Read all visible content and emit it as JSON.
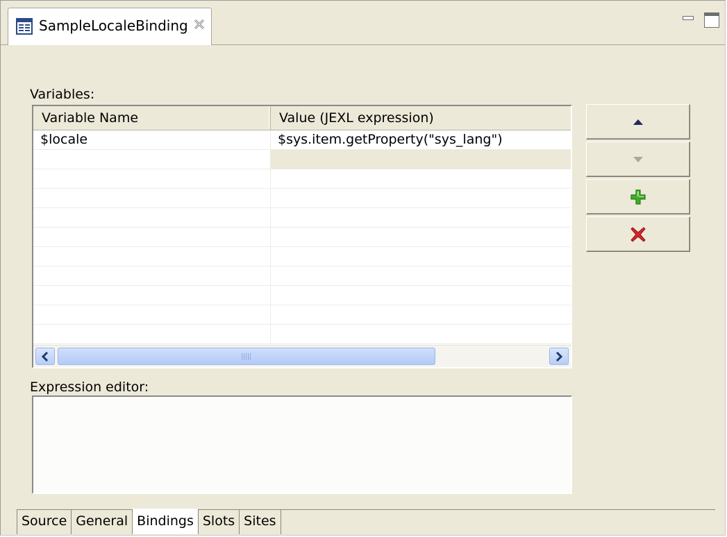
{
  "editor_tab": {
    "title": "SampleLocaleBinding",
    "icon": "form-editor-icon",
    "close_icon": "close-icon"
  },
  "window_controls": {
    "minimize_icon": "minimize-icon",
    "maximize_icon": "maximize-icon"
  },
  "variables": {
    "label": "Variables:",
    "columns": [
      "Variable Name",
      "Value (JEXL expression)"
    ],
    "rows": [
      {
        "name": "$locale",
        "value": "$sys.item.getProperty(\"sys_lang\")"
      },
      {
        "name": "",
        "value": ""
      },
      {
        "name": "",
        "value": ""
      },
      {
        "name": "",
        "value": ""
      },
      {
        "name": "",
        "value": ""
      },
      {
        "name": "",
        "value": ""
      },
      {
        "name": "",
        "value": ""
      },
      {
        "name": "",
        "value": ""
      },
      {
        "name": "",
        "value": ""
      },
      {
        "name": "",
        "value": ""
      },
      {
        "name": "",
        "value": ""
      }
    ],
    "scrollbar": {
      "left_icon": "chevron-left-icon",
      "right_icon": "chevron-right-icon"
    }
  },
  "expression_editor": {
    "label": "Expression editor:",
    "value": ""
  },
  "side_buttons": {
    "move_up_icon": "arrow-up-icon",
    "move_down_icon": "arrow-down-icon",
    "add_icon": "plus-icon",
    "delete_icon": "delete-x-icon"
  },
  "bottom_tabs": [
    {
      "label": "Source"
    },
    {
      "label": "General"
    },
    {
      "label": "Bindings",
      "active": true
    },
    {
      "label": "Slots"
    },
    {
      "label": "Sites"
    }
  ],
  "colors": {
    "panel_bg": "#ece9d8",
    "up_arrow": "#1f2a5e",
    "down_arrow_disabled": "#aca899",
    "add_green": "#3fae2a",
    "delete_red": "#d9232a"
  }
}
